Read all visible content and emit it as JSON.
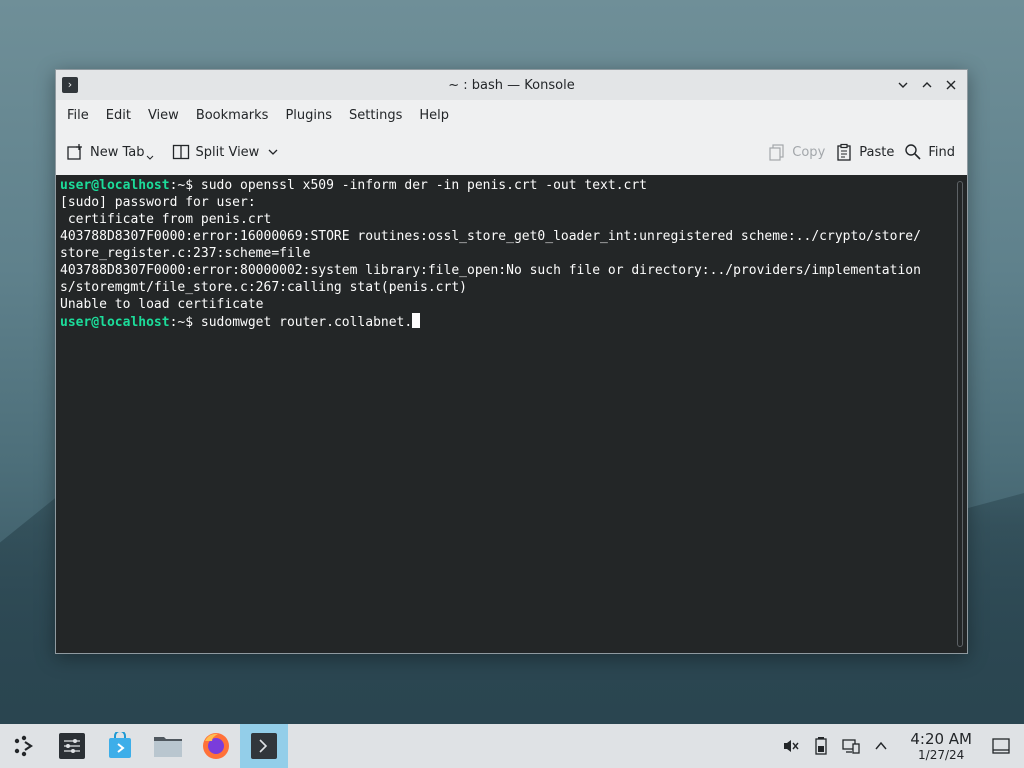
{
  "window": {
    "title": "~ : bash — Konsole",
    "controls": [
      "minimize",
      "maximize",
      "close"
    ]
  },
  "menu": [
    "File",
    "Edit",
    "View",
    "Bookmarks",
    "Plugins",
    "Settings",
    "Help"
  ],
  "toolbar": {
    "new_tab": "New Tab",
    "split_view": "Split View",
    "copy": "Copy",
    "paste": "Paste",
    "find": "Find"
  },
  "terminal": {
    "prompt": "user@localhost",
    "prompt_suffix": ":~$ ",
    "command1": "sudo openssl x509 -inform der -in penis.crt -out text.crt",
    "lines": [
      "[sudo] password for user:",
      " certificate from penis.crt",
      "403788D8307F0000:error:16000069:STORE routines:ossl_store_get0_loader_int:unregistered scheme:../crypto/store/",
      "store_register.c:237:scheme=file",
      "403788D8307F0000:error:80000002:system library:file_open:No such file or directory:../providers/implementation",
      "s/storemgmt/file_store.c:267:calling stat(penis.crt)",
      "Unable to load certificate"
    ],
    "command2": "sudomwget router.collabnet.",
    "colors": {
      "background": "#232627",
      "prompt": "#1cdc9a",
      "text": "#fcfcfc"
    }
  },
  "taskbar": {
    "items": [
      "application-launcher-icon",
      "system-settings-icon",
      "discover-icon",
      "dolphin-icon",
      "firefox-icon",
      "konsole-icon"
    ],
    "active_item": "konsole-icon",
    "time": "4:20 AM",
    "date": "1/27/24"
  }
}
